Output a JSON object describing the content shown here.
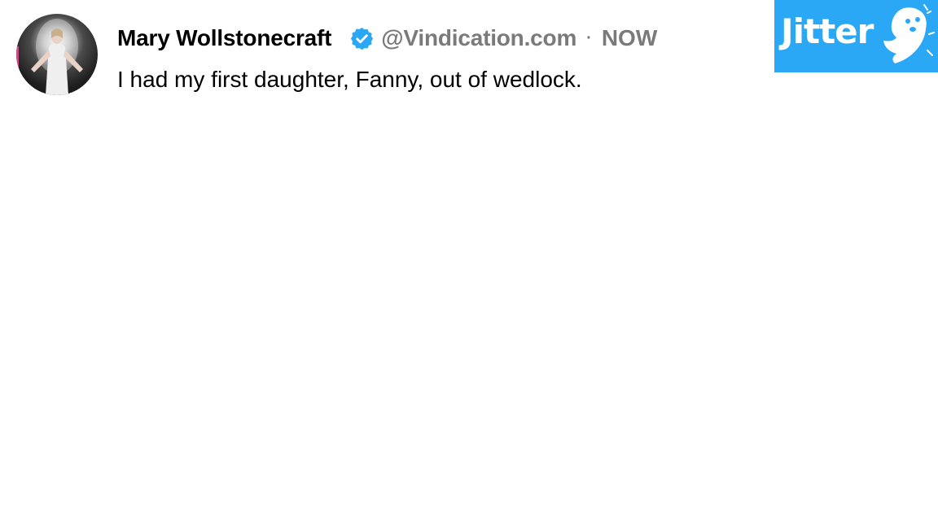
{
  "tweet": {
    "author_name": "Mary Wollstonecraft",
    "handle": "@Vindication.com",
    "separator": "·",
    "timestamp": "NOW",
    "text": "I had my first daughter, Fanny, out of wedlock.",
    "verified": true
  },
  "brand": {
    "name": "Jitter",
    "background_color": "#2aa8f5",
    "icon": "ghost-bird-icon"
  },
  "colors": {
    "verified_badge": "#2aa8f5",
    "muted_text": "#7a7a7a"
  }
}
